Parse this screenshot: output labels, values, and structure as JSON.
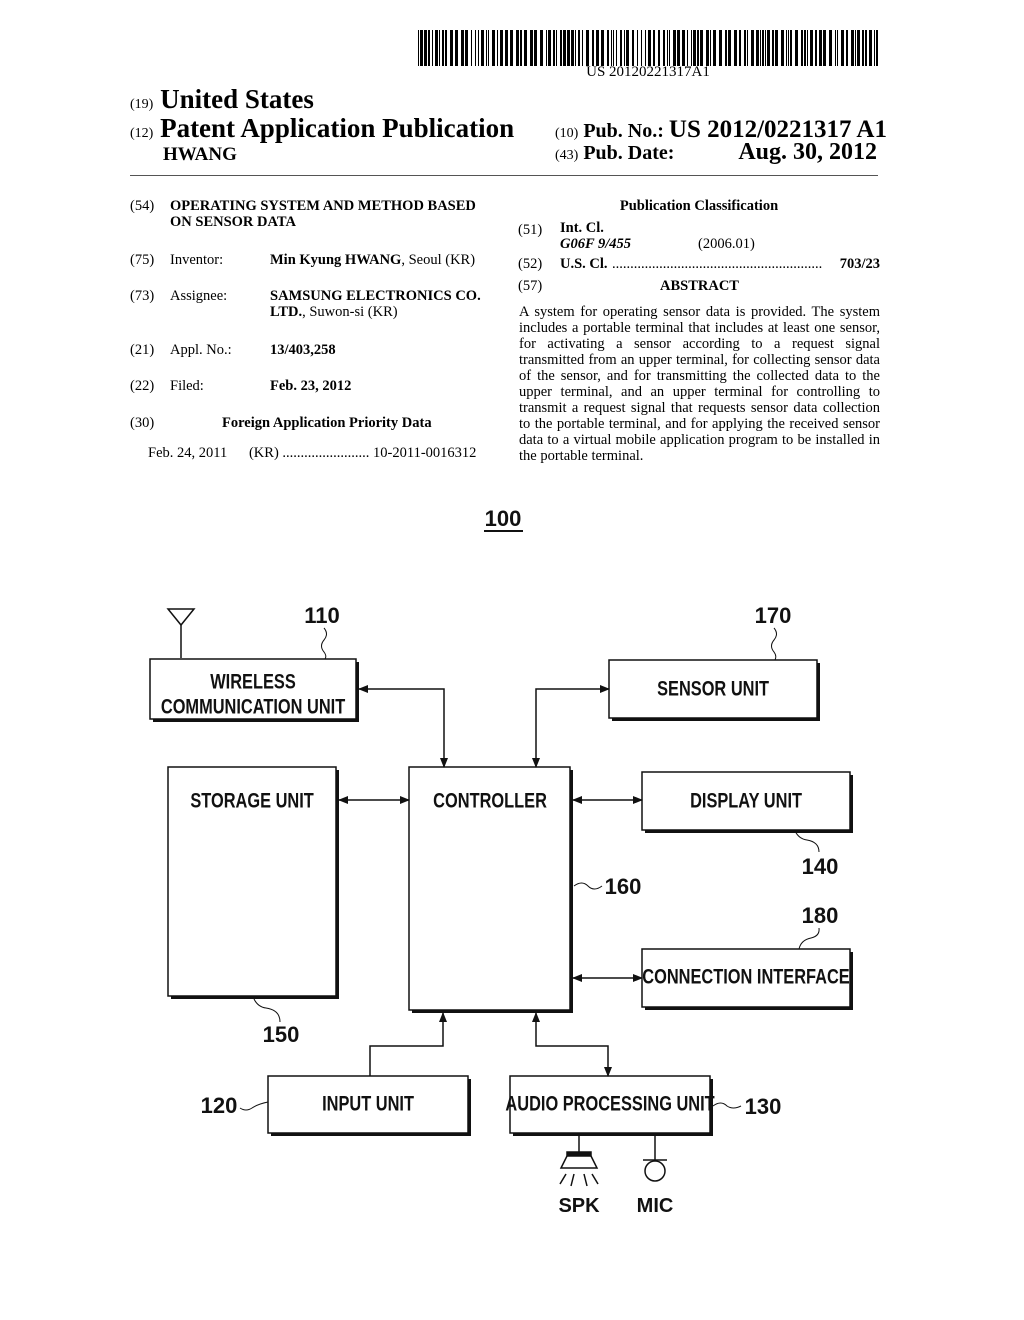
{
  "header": {
    "barcode_number": "US 20120221317A1",
    "country_code": "(19)",
    "country": "United States",
    "doc_type_code": "(12)",
    "doc_type": "Patent Application Publication",
    "inventor_surname": "HWANG",
    "pub_no_code": "(10)",
    "pub_no_label": "Pub. No.:",
    "pub_no": "US 2012/0221317 A1",
    "pub_date_code": "(43)",
    "pub_date_label": "Pub. Date:",
    "pub_date": "Aug. 30, 2012"
  },
  "biblio": {
    "title_code": "(54)",
    "title": "OPERATING SYSTEM AND METHOD BASED ON SENSOR DATA",
    "inventor_code": "(75)",
    "inventor_label": "Inventor:",
    "inventor_name": "Min Kyung HWANG",
    "inventor_location": ", Seoul (KR)",
    "assignee_code": "(73)",
    "assignee_label": "Assignee:",
    "assignee_name_1": "SAMSUNG ELECTRONICS CO.",
    "assignee_name_2": "LTD.",
    "assignee_location": ", Suwon-si (KR)",
    "appl_code": "(21)",
    "appl_label": "Appl. No.:",
    "appl_no": "13/403,258",
    "filed_code": "(22)",
    "filed_label": "Filed:",
    "filed_date": "Feb. 23, 2012",
    "priority_code": "(30)",
    "priority_heading": "Foreign Application Priority Data",
    "priority_date": "Feb. 24, 2011",
    "priority_country": "(KR)",
    "priority_dots": "........................",
    "priority_number": "10-2011-0016312"
  },
  "classification": {
    "heading": "Publication Classification",
    "int_cl_code": "(51)",
    "int_cl_label": "Int. Cl.",
    "int_cl_value": "G06F 9/455",
    "int_cl_version": "(2006.01)",
    "us_cl_code": "(52)",
    "us_cl_label": "U.S. Cl.",
    "us_cl_dots": "..........................................................",
    "us_cl_value": "703/23",
    "abstract_code": "(57)",
    "abstract_heading": "ABSTRACT",
    "abstract_text": "A system for operating sensor data is provided. The system includes a portable terminal that includes at least one sensor, for activating a sensor according to a request signal transmitted from an upper terminal, for collecting sensor data of the sensor, and for transmitting the collected data to the upper terminal, and an upper terminal for controlling to transmit a request signal that requests sensor data collection to the portable terminal, and for applying the received sensor data to a virtual mobile application program to be installed in the portable terminal."
  },
  "figure": {
    "figure_ref": "100",
    "blocks": {
      "wireless_line1": "WIRELESS",
      "wireless_line2": "COMMUNICATION UNIT",
      "wireless_ref": "110",
      "sensor": "SENSOR UNIT",
      "sensor_ref": "170",
      "storage": "STORAGE UNIT",
      "storage_ref": "150",
      "controller": "CONTROLLER",
      "controller_ref": "160",
      "display": "DISPLAY UNIT",
      "display_ref": "140",
      "connection": "CONNECTION INTERFACE",
      "connection_ref": "180",
      "input": "INPUT UNIT",
      "input_ref": "120",
      "audio": "AUDIO PROCESSING UNIT",
      "audio_ref": "130",
      "speaker": "SPK",
      "mic": "MIC"
    }
  }
}
